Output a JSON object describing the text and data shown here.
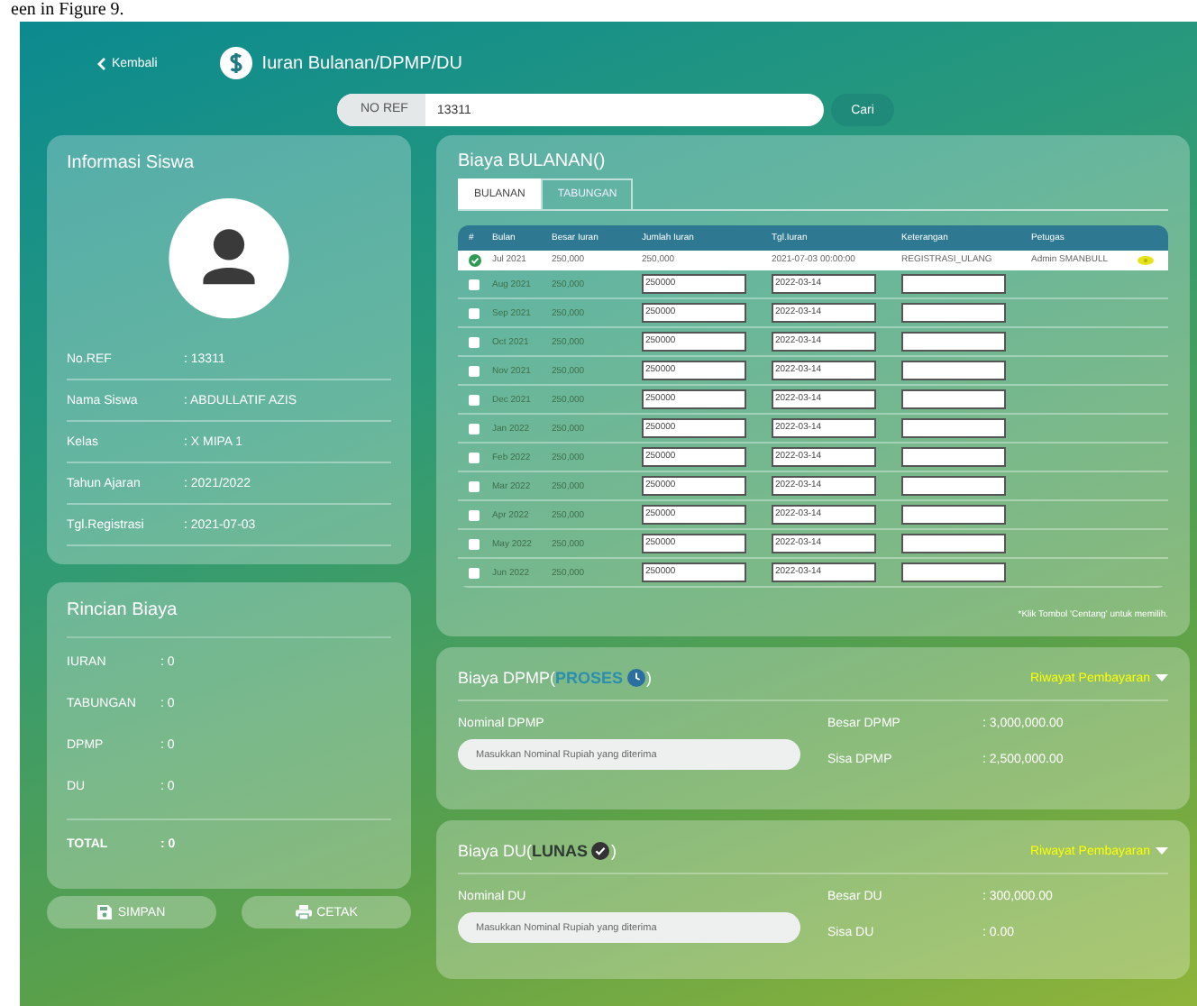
{
  "caption": "een in Figure 9.",
  "header": {
    "back": "Kembali",
    "title": "Iuran Bulanan/DPMP/DU"
  },
  "search": {
    "label": "NO REF",
    "value": "13311",
    "button": "Cari"
  },
  "student": {
    "title": "Informasi Siswa",
    "fields": [
      {
        "label": "No.REF",
        "value": ": 13311"
      },
      {
        "label": "Nama Siswa",
        "value": ": ABDULLATIF AZIS"
      },
      {
        "label": "Kelas",
        "value": ": X MIPA 1"
      },
      {
        "label": "Tahun Ajaran",
        "value": ": 2021/2022"
      },
      {
        "label": "Tgl.Registrasi",
        "value": ": 2021-07-03"
      }
    ]
  },
  "summary": {
    "title": "Rincian Biaya",
    "items": [
      {
        "label": "IURAN",
        "value": ": 0"
      },
      {
        "label": "TABUNGAN",
        "value": ": 0"
      },
      {
        "label": "DPMP",
        "value": ": 0"
      },
      {
        "label": "DU",
        "value": ": 0"
      }
    ],
    "total": {
      "label": "TOTAL",
      "value": ": 0"
    }
  },
  "actions": [
    {
      "label": "SIMPAN",
      "kind": "save"
    },
    {
      "label": "CETAK",
      "kind": "print"
    }
  ],
  "monthly": {
    "title": "Biaya BULANAN()",
    "tabs": [
      {
        "label": "BULANAN",
        "selected": true
      },
      {
        "label": "TABUNGAN",
        "selected": false
      }
    ],
    "columns": [
      "#",
      "Bulan",
      "Besar Iuran",
      "Jumlah Iuran",
      "Tgl.Iuran",
      "Keterangan",
      "Petugas"
    ],
    "rows": [
      {
        "kind": "paid",
        "month": "Jul 2021",
        "fee": "250,000",
        "amount": "250,000",
        "date": "2021-07-03 00:00:00",
        "note": "REGISTRASI_ULANG",
        "officer": "Admin SMANBULL"
      },
      {
        "kind": "unpaid",
        "checked": false,
        "month": "Aug 2021",
        "fee": "250,000",
        "amount": "250000",
        "date": "2022-03-14"
      },
      {
        "kind": "unpaid",
        "checked": false,
        "month": "Sep 2021",
        "fee": "250,000",
        "amount": "250000",
        "date": "2022-03-14"
      },
      {
        "kind": "unpaid",
        "checked": false,
        "month": "Oct 2021",
        "fee": "250,000",
        "amount": "250000",
        "date": "2022-03-14"
      },
      {
        "kind": "unpaid",
        "checked": false,
        "month": "Nov 2021",
        "fee": "250,000",
        "amount": "250000",
        "date": "2022-03-14"
      },
      {
        "kind": "unpaid",
        "checked": false,
        "month": "Dec 2021",
        "fee": "250,000",
        "amount": "250000",
        "date": "2022-03-14"
      },
      {
        "kind": "unpaid",
        "checked": false,
        "month": "Jan 2022",
        "fee": "250,000",
        "amount": "250000",
        "date": "2022-03-14"
      },
      {
        "kind": "unpaid",
        "checked": false,
        "month": "Feb 2022",
        "fee": "250,000",
        "amount": "250000",
        "date": "2022-03-14"
      },
      {
        "kind": "unpaid",
        "checked": false,
        "month": "Mar 2022",
        "fee": "250,000",
        "amount": "250000",
        "date": "2022-03-14"
      },
      {
        "kind": "unpaid",
        "checked": false,
        "month": "Apr 2022",
        "fee": "250,000",
        "amount": "250000",
        "date": "2022-03-14"
      },
      {
        "kind": "unpaid",
        "checked": false,
        "month": "May 2022",
        "fee": "250,000",
        "amount": "250000",
        "date": "2022-03-14"
      },
      {
        "kind": "unpaid",
        "checked": false,
        "month": "Jun 2022",
        "fee": "250,000",
        "amount": "250000",
        "date": "2022-03-14"
      }
    ],
    "note": "*Klik Tombol 'Centang' untuk memilih."
  },
  "fees": [
    {
      "title": "Biaya DPMP(",
      "status": {
        "label": "PROSES",
        "kind": "process"
      },
      "close": ")",
      "history": "Riwayat Pembayaran",
      "input_label": "Nominal DPMP",
      "placeholder": "Masukkan Nominal Rupiah yang diterima",
      "facts": [
        {
          "label": "Besar DPMP",
          "value": ": 3,000,000.00"
        },
        {
          "label": "Sisa DPMP",
          "value": ": 2,500,000.00"
        }
      ]
    },
    {
      "title": "Biaya DU(",
      "status": {
        "label": "LUNAS",
        "kind": "paid"
      },
      "close": ")",
      "history": "Riwayat Pembayaran",
      "input_label": "Nominal DU",
      "placeholder": "Masukkan Nominal Rupiah yang diterima",
      "facts": [
        {
          "label": "Besar DU",
          "value": ": 300,000.00"
        },
        {
          "label": "Sisa DU",
          "value": ": 0.00"
        }
      ]
    }
  ]
}
